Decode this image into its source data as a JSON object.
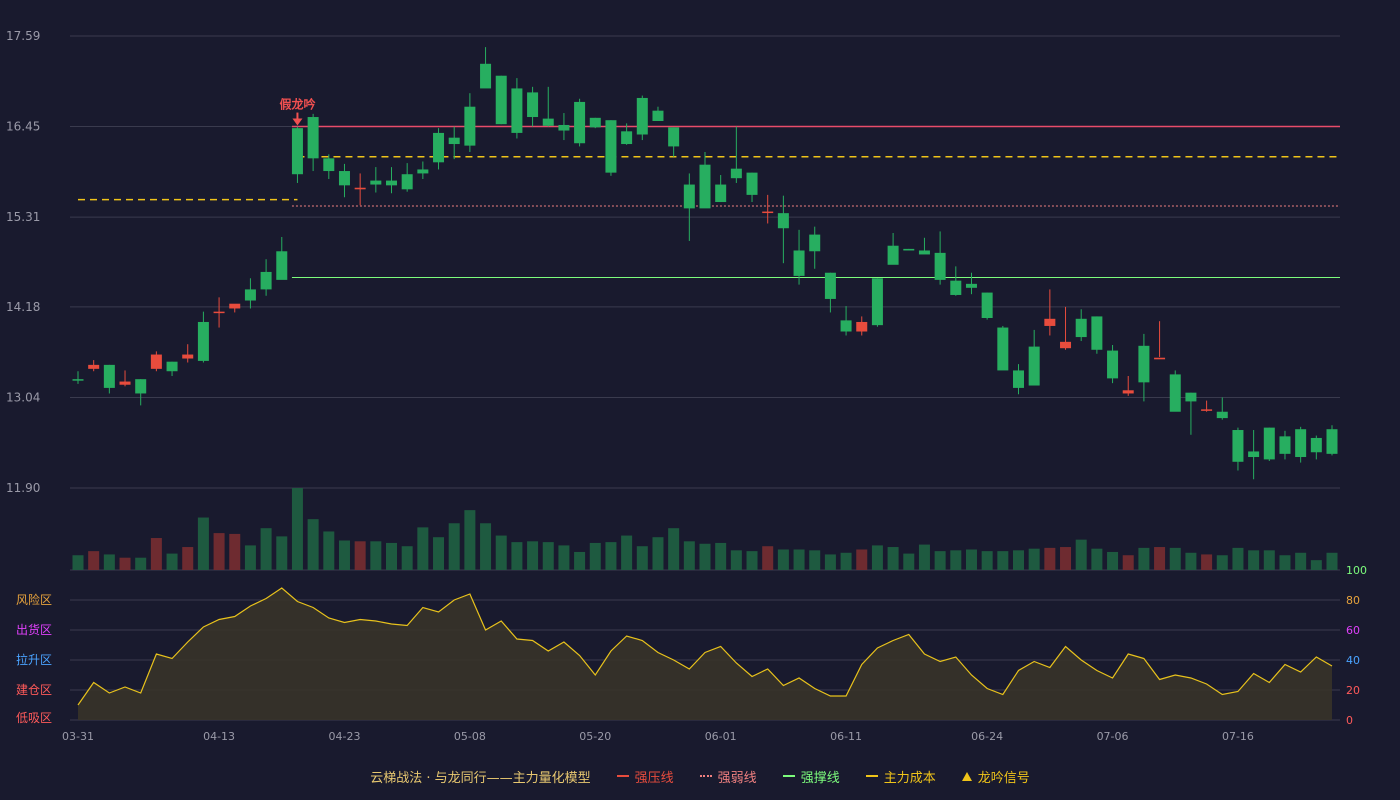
{
  "colors": {
    "background": "#191a2e",
    "grid": "#3a3b4e",
    "axis_text": "#9a9aa8",
    "up": "#e84c3d",
    "down": "#27ae60",
    "up_volume": "#6e2b30",
    "down_volume": "#1e5a40",
    "pressure_line": "#e84c6a",
    "weak_line": "#f08080",
    "support_line": "#7cfc7c",
    "main_cost": "#f0c419",
    "indicator_line": "#e8c21c",
    "indicator_fill": "#3a3528",
    "signal": "#f05050"
  },
  "chart_data": {
    "type": "candlestick",
    "dates": [
      "03-31",
      "04-01",
      "04-02",
      "04-03",
      "04-06",
      "04-07",
      "04-08",
      "04-09",
      "04-10",
      "04-13",
      "04-14",
      "04-15",
      "04-16",
      "04-17",
      "04-20",
      "04-21",
      "04-22",
      "04-23",
      "04-24",
      "04-27",
      "04-28",
      "04-29",
      "04-30",
      "05-06",
      "05-07",
      "05-08",
      "05-11",
      "05-12",
      "05-13",
      "05-14",
      "05-15",
      "05-18",
      "05-19",
      "05-20",
      "05-21",
      "05-22",
      "05-25",
      "05-26",
      "05-27",
      "05-28",
      "05-29",
      "06-01",
      "06-02",
      "06-03",
      "06-04",
      "06-05",
      "06-08",
      "06-09",
      "06-10",
      "06-11",
      "06-12",
      "06-15",
      "06-16",
      "06-17",
      "06-18",
      "06-19",
      "06-22",
      "06-23",
      "06-24",
      "06-25",
      "06-26",
      "06-29",
      "06-30",
      "07-01",
      "07-02",
      "07-03",
      "07-06",
      "07-07",
      "07-08",
      "07-09",
      "07-10",
      "07-13",
      "07-14",
      "07-15",
      "07-16",
      "07-17",
      "07-20",
      "07-21",
      "07-22",
      "07-23",
      "07-24"
    ],
    "x_ticks": [
      "03-31",
      "04-13",
      "04-23",
      "05-08",
      "05-20",
      "06-01",
      "06-11",
      "06-24",
      "07-06",
      "07-16"
    ],
    "y_ticks": [
      "17.59",
      "16.45",
      "15.31",
      "14.18",
      "13.04",
      "11.90"
    ],
    "ylim": [
      11.9,
      17.59
    ],
    "ohlc": [
      [
        13.27,
        13.37,
        13.21,
        13.26
      ],
      [
        13.4,
        13.51,
        13.37,
        13.45
      ],
      [
        13.45,
        13.45,
        13.09,
        13.16
      ],
      [
        13.2,
        13.38,
        13.18,
        13.24
      ],
      [
        13.27,
        13.27,
        12.94,
        13.09
      ],
      [
        13.4,
        13.62,
        13.37,
        13.58
      ],
      [
        13.49,
        13.49,
        13.31,
        13.37
      ],
      [
        13.53,
        13.71,
        13.48,
        13.58
      ],
      [
        13.99,
        14.12,
        13.48,
        13.5
      ],
      [
        14.12,
        14.3,
        13.92,
        14.12
      ],
      [
        14.16,
        14.21,
        14.11,
        14.22
      ],
      [
        14.4,
        14.54,
        14.16,
        14.26
      ],
      [
        14.62,
        14.78,
        14.32,
        14.4
      ],
      [
        14.88,
        15.06,
        14.8,
        14.52
      ],
      [
        16.43,
        16.45,
        15.74,
        15.85
      ],
      [
        16.57,
        16.61,
        15.89,
        16.05
      ],
      [
        16.05,
        16.1,
        15.79,
        15.89
      ],
      [
        15.89,
        15.98,
        15.56,
        15.71
      ],
      [
        15.66,
        15.86,
        15.46,
        15.68
      ],
      [
        15.77,
        15.94,
        15.62,
        15.72
      ],
      [
        15.77,
        15.94,
        15.61,
        15.71
      ],
      [
        15.85,
        15.99,
        15.63,
        15.66
      ],
      [
        15.91,
        16.01,
        15.79,
        15.86
      ],
      [
        16.37,
        16.43,
        15.91,
        16.0
      ],
      [
        16.31,
        16.45,
        16.04,
        16.23
      ],
      [
        16.7,
        16.87,
        16.13,
        16.21
      ],
      [
        17.24,
        17.45,
        16.98,
        16.93
      ],
      [
        17.09,
        17.09,
        16.48,
        16.48
      ],
      [
        16.93,
        17.06,
        16.3,
        16.37
      ],
      [
        16.88,
        16.95,
        16.45,
        16.57
      ],
      [
        16.55,
        16.95,
        16.45,
        16.46
      ],
      [
        16.47,
        16.62,
        16.28,
        16.4
      ],
      [
        16.76,
        16.8,
        16.2,
        16.24
      ],
      [
        16.56,
        16.56,
        16.43,
        16.44
      ],
      [
        16.53,
        16.53,
        15.83,
        15.87
      ],
      [
        16.39,
        16.49,
        16.22,
        16.23
      ],
      [
        16.81,
        16.84,
        16.28,
        16.35
      ],
      [
        16.65,
        16.7,
        16.53,
        16.52
      ],
      [
        16.44,
        16.44,
        16.07,
        16.2
      ],
      [
        15.72,
        15.86,
        15.01,
        15.42
      ],
      [
        15.97,
        16.13,
        15.43,
        15.42
      ],
      [
        15.72,
        15.84,
        15.5,
        15.5
      ],
      [
        15.92,
        16.45,
        15.74,
        15.8
      ],
      [
        15.87,
        15.87,
        15.5,
        15.59
      ],
      [
        15.38,
        15.59,
        15.23,
        15.38
      ],
      [
        15.36,
        15.58,
        14.73,
        15.17
      ],
      [
        14.89,
        15.15,
        14.46,
        14.57
      ],
      [
        15.09,
        15.19,
        14.66,
        14.88
      ],
      [
        14.61,
        14.61,
        14.11,
        14.28
      ],
      [
        14.01,
        14.19,
        13.82,
        13.87
      ],
      [
        13.87,
        14.06,
        13.82,
        13.99
      ],
      [
        14.54,
        14.54,
        13.93,
        13.95
      ],
      [
        14.95,
        15.11,
        14.78,
        14.71
      ],
      [
        14.91,
        14.91,
        14.9,
        14.89
      ],
      [
        14.89,
        15.05,
        14.87,
        14.84
      ],
      [
        14.86,
        15.13,
        14.46,
        14.52
      ],
      [
        14.51,
        14.69,
        14.32,
        14.33
      ],
      [
        14.47,
        14.61,
        14.34,
        14.42
      ],
      [
        14.36,
        14.36,
        14.02,
        14.04
      ],
      [
        13.92,
        13.94,
        13.39,
        13.38
      ],
      [
        13.38,
        13.46,
        13.08,
        13.16
      ],
      [
        13.68,
        13.89,
        13.28,
        13.19
      ],
      [
        13.94,
        14.4,
        13.82,
        14.03
      ],
      [
        13.66,
        14.18,
        13.64,
        13.74
      ],
      [
        14.03,
        14.15,
        13.75,
        13.8
      ],
      [
        14.06,
        14.06,
        13.59,
        13.64
      ],
      [
        13.63,
        13.7,
        13.22,
        13.28
      ],
      [
        13.09,
        13.31,
        13.06,
        13.13
      ],
      [
        13.69,
        13.84,
        12.99,
        13.23
      ],
      [
        13.52,
        14.0,
        13.55,
        13.54
      ],
      [
        13.33,
        13.38,
        12.87,
        12.86
      ],
      [
        13.1,
        13.1,
        12.57,
        12.99
      ],
      [
        12.88,
        13.0,
        12.86,
        12.89
      ],
      [
        12.86,
        13.04,
        12.76,
        12.78
      ],
      [
        12.63,
        12.66,
        12.12,
        12.23
      ],
      [
        12.36,
        12.63,
        12.01,
        12.29
      ],
      [
        12.66,
        12.66,
        12.24,
        12.26
      ],
      [
        12.55,
        12.62,
        12.26,
        12.33
      ],
      [
        12.64,
        12.67,
        12.22,
        12.29
      ],
      [
        12.53,
        12.56,
        12.26,
        12.35
      ],
      [
        12.64,
        12.69,
        12.31,
        12.33
      ]
    ],
    "volume": [
      0.18,
      0.23,
      0.19,
      0.15,
      0.15,
      0.39,
      0.2,
      0.28,
      0.64,
      0.45,
      0.44,
      0.3,
      0.51,
      0.41,
      1.0,
      0.62,
      0.47,
      0.36,
      0.35,
      0.35,
      0.33,
      0.29,
      0.52,
      0.4,
      0.57,
      0.73,
      0.57,
      0.42,
      0.34,
      0.35,
      0.34,
      0.3,
      0.22,
      0.33,
      0.34,
      0.42,
      0.29,
      0.4,
      0.51,
      0.35,
      0.32,
      0.33,
      0.24,
      0.23,
      0.29,
      0.25,
      0.25,
      0.24,
      0.19,
      0.21,
      0.25,
      0.3,
      0.28,
      0.2,
      0.31,
      0.23,
      0.24,
      0.25,
      0.23,
      0.23,
      0.24,
      0.26,
      0.27,
      0.28,
      0.37,
      0.26,
      0.22,
      0.18,
      0.27,
      0.28,
      0.27,
      0.21,
      0.19,
      0.18,
      0.27,
      0.24,
      0.24,
      0.18,
      0.21,
      0.12,
      0.21
    ],
    "indicator": {
      "y_ticks": [
        0,
        20,
        40,
        60,
        80,
        100
      ],
      "ylim": [
        0,
        100
      ],
      "zones": [
        "风险区",
        "出货区",
        "拉升区",
        "建仓区",
        "低吸区"
      ],
      "values": [
        10,
        25,
        18,
        22,
        18,
        44,
        41,
        52,
        62,
        67,
        69,
        76,
        81,
        88,
        79,
        75,
        68,
        65,
        67,
        66,
        64,
        63,
        75,
        72,
        80,
        84,
        60,
        66,
        54,
        53,
        46,
        52,
        43,
        30,
        46,
        56,
        53,
        45,
        40,
        34,
        45,
        49,
        38,
        29,
        34,
        23,
        28,
        21,
        16,
        16,
        37,
        48,
        53,
        57,
        44,
        39,
        42,
        30,
        21,
        17,
        33,
        39,
        35,
        49,
        40,
        33,
        28,
        44,
        41,
        27,
        30,
        28,
        24,
        17,
        19,
        31,
        25,
        37,
        32,
        42,
        36
      ]
    },
    "lines": {
      "strong_pressure": 16.45,
      "weak_line": 15.45,
      "support": 14.55,
      "main_cost_1": 15.53,
      "main_cost_2": 16.07,
      "main_cost_1_start": "03-31",
      "main_cost_1_end": "04-20",
      "main_cost_2_start": "04-20",
      "lines_start": "04-20"
    },
    "signals": [
      {
        "date": "04-20",
        "label": "假龙吟"
      }
    ]
  },
  "legend": {
    "title": "云梯战法 · 与龙同行——主力量化模型",
    "items": [
      {
        "label": "强压线",
        "style": "solid",
        "color": "#e84c3d"
      },
      {
        "label": "强弱线",
        "style": "dot",
        "color": "#f08080"
      },
      {
        "label": "强撑线",
        "style": "solid",
        "color": "#7cfc7c"
      },
      {
        "label": "主力成本",
        "style": "dash",
        "color": "#f0c419"
      },
      {
        "label": "龙吟信号",
        "style": "tri",
        "color": "#f0c419"
      }
    ]
  }
}
